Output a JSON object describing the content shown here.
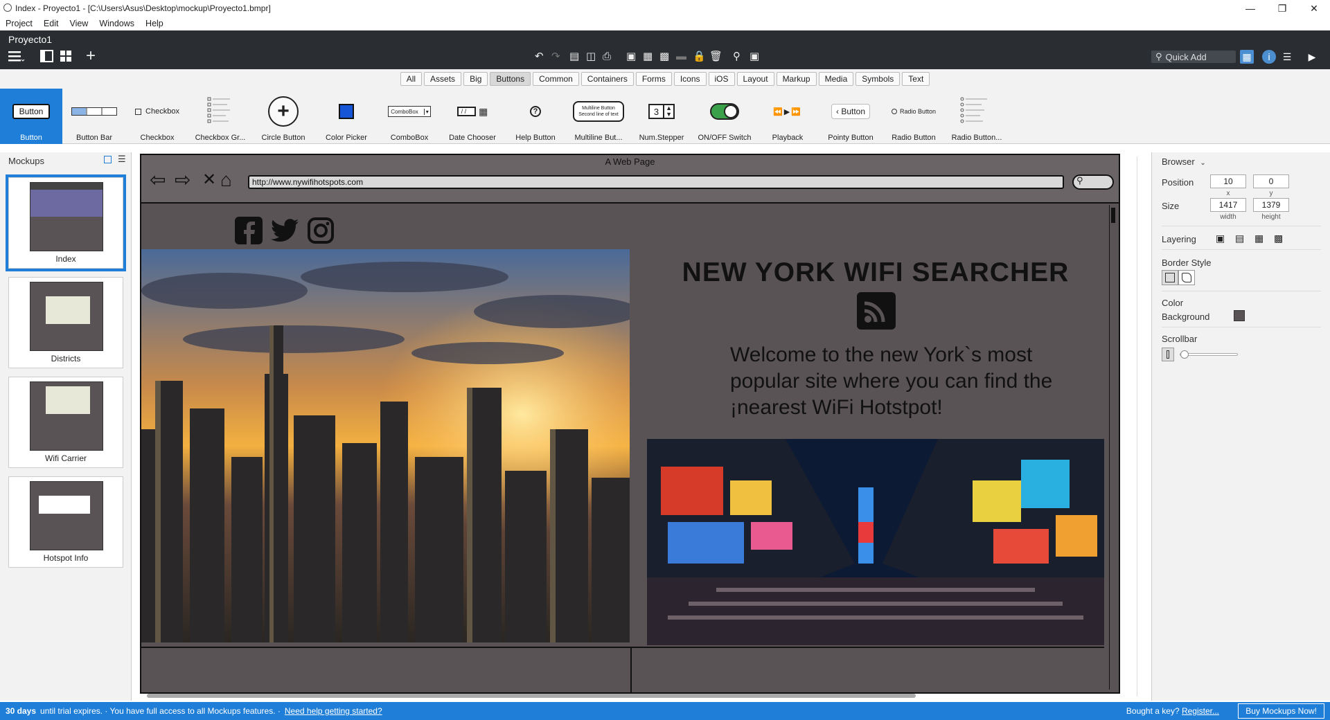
{
  "window": {
    "title": "Index - Proyecto1 - [C:\\Users\\Asus\\Desktop\\mockup\\Proyecto1.bmpr]"
  },
  "menu": [
    "Project",
    "Edit",
    "View",
    "Windows",
    "Help"
  ],
  "toolbar": {
    "project_title": "Proyecto1",
    "quick_add": "Quick Add"
  },
  "filters": [
    "All",
    "Assets",
    "Big",
    "Buttons",
    "Common",
    "Containers",
    "Forms",
    "Icons",
    "iOS",
    "Layout",
    "Markup",
    "Media",
    "Symbols",
    "Text"
  ],
  "selected_filter": "Buttons",
  "components": [
    {
      "label": "Button",
      "preview": "Button"
    },
    {
      "label": "Button Bar",
      "preview": ""
    },
    {
      "label": "Checkbox",
      "preview": "Checkbox"
    },
    {
      "label": "Checkbox Gr...",
      "preview": ""
    },
    {
      "label": "Circle Button",
      "preview": "+"
    },
    {
      "label": "Color Picker",
      "preview": ""
    },
    {
      "label": "ComboBox",
      "preview": "ComboBox"
    },
    {
      "label": "Date Chooser",
      "preview": "/ /"
    },
    {
      "label": "Help Button",
      "preview": "?"
    },
    {
      "label": "Multiline But...",
      "preview": "Multiline Button"
    },
    {
      "label": "Num.Stepper",
      "preview": "3"
    },
    {
      "label": "ON/OFF Switch",
      "preview": ""
    },
    {
      "label": "Playback",
      "preview": "◀◀ ▶ ▶▶"
    },
    {
      "label": "Pointy Button",
      "preview": "Button"
    },
    {
      "label": "Radio Button",
      "preview": "Radio Button"
    },
    {
      "label": "Radio Button...",
      "preview": ""
    }
  ],
  "mockups_panel": {
    "title": "Mockups",
    "items": [
      {
        "label": "Index"
      },
      {
        "label": "Districts"
      },
      {
        "label": "Wifi Carrier"
      },
      {
        "label": "Hotspot Info"
      }
    ]
  },
  "mockup": {
    "window_title": "A Web Page",
    "url": "http://www.nywifihotspots.com",
    "heading": "NEW YORK WIFI SEARCHER",
    "welcome": "Welcome to the new York`s most popular site where you can find the ¡nearest WiFi Hotstpot!"
  },
  "properties": {
    "header": "Browser",
    "position_label": "Position",
    "x": "10",
    "y": "0",
    "x_label": "x",
    "y_label": "y",
    "size_label": "Size",
    "width": "1417",
    "height": "1379",
    "width_label": "width",
    "height_label": "height",
    "layering_label": "Layering",
    "border_style_label": "Border Style",
    "color_label": "Color",
    "background_label": "Background",
    "scrollbar_label": "Scrollbar"
  },
  "status": {
    "days": "30 days",
    "trial": "until trial expires.  ·  You have full access to all Mockups features.  ·",
    "help_link": "Need help getting started?",
    "bought": "Bought a key?",
    "register": "Register...",
    "buy": "Buy Mockups Now!"
  },
  "colors": {
    "accent": "#1f7fd8",
    "mockup_bg": "#5a5356",
    "dark_toolbar": "#2a2d31"
  }
}
